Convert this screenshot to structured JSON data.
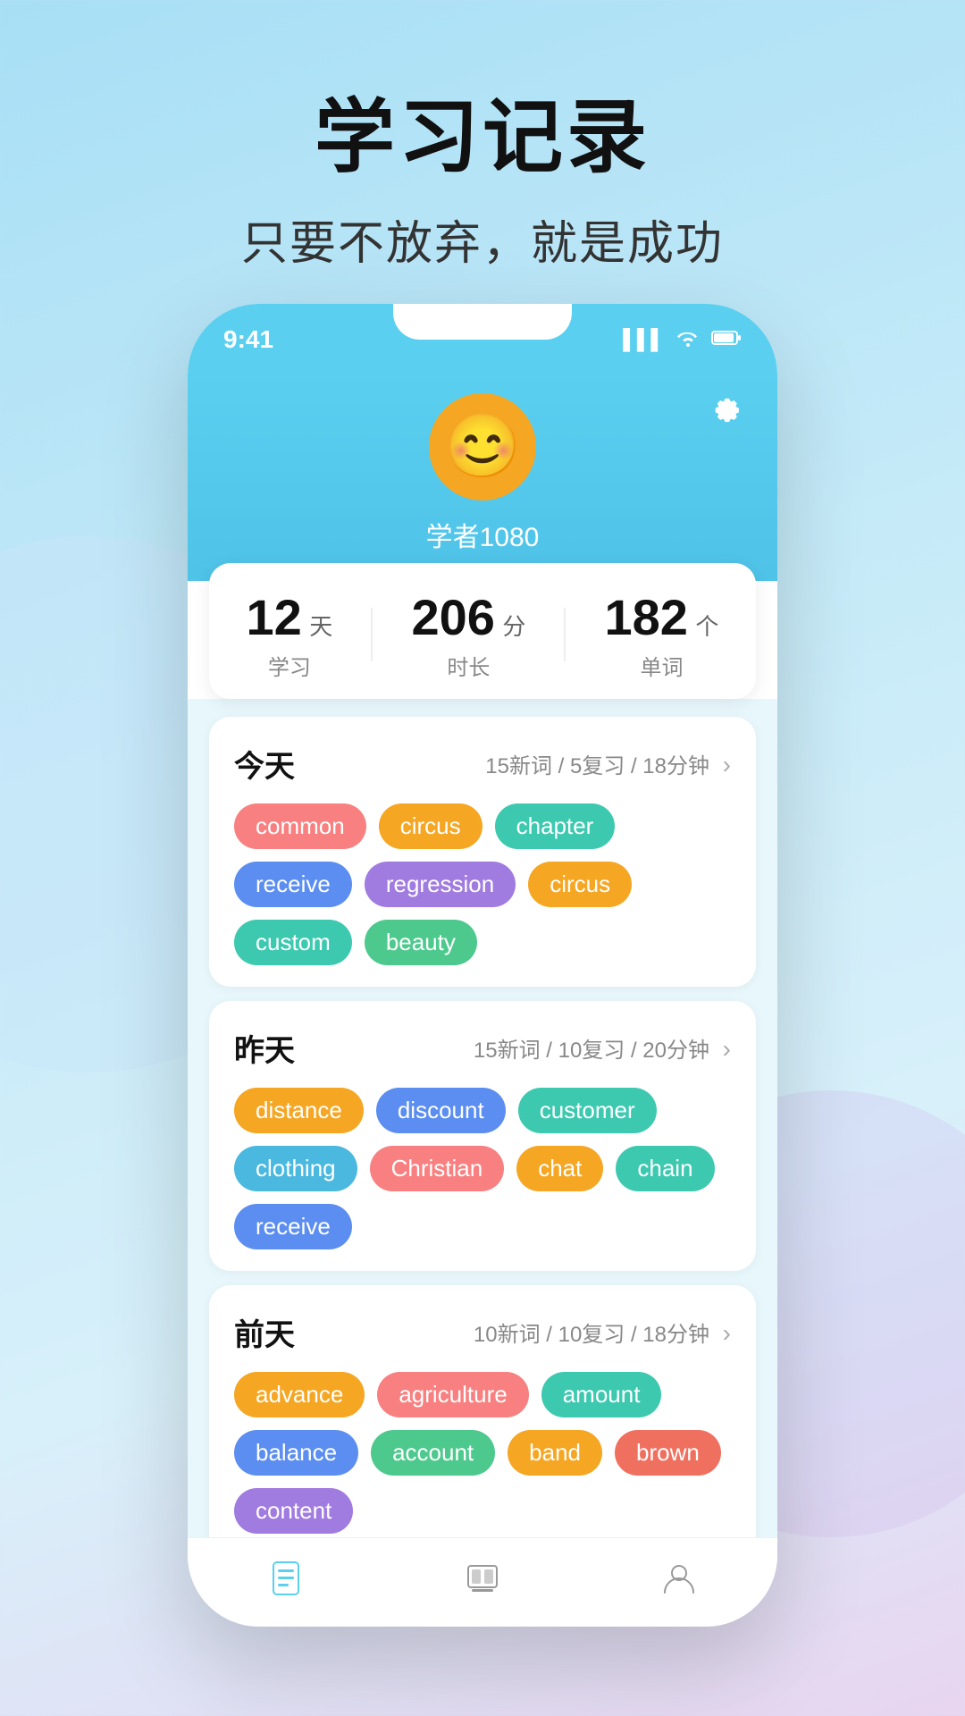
{
  "background": {
    "color": "#a8dff5"
  },
  "header": {
    "title": "学习记录",
    "subtitle": "只要不放弃，就是成功"
  },
  "phone": {
    "status_bar": {
      "time": "9:41",
      "signal": "▌▌▌",
      "wifi": "WiFi",
      "battery": "Battery"
    },
    "profile": {
      "username": "学者1080",
      "avatar_emoji": "😊"
    },
    "stats": {
      "days": "12",
      "days_unit": "天",
      "days_label": "学习",
      "minutes": "206",
      "minutes_unit": "分",
      "minutes_label": "时长",
      "words": "182",
      "words_unit": "个",
      "words_label": "单词"
    },
    "today": {
      "title": "今天",
      "stats": "15新词 / 5复习 / 18分钟",
      "words": [
        {
          "text": "common",
          "color": "tag-pink"
        },
        {
          "text": "circus",
          "color": "tag-orange"
        },
        {
          "text": "chapter",
          "color": "tag-teal"
        },
        {
          "text": "receive",
          "color": "tag-blue"
        },
        {
          "text": "regression",
          "color": "tag-purple"
        },
        {
          "text": "circus",
          "color": "tag-orange"
        },
        {
          "text": "custom",
          "color": "tag-teal"
        },
        {
          "text": "beauty",
          "color": "tag-green"
        }
      ]
    },
    "yesterday": {
      "title": "昨天",
      "stats": "15新词 / 10复习 / 20分钟",
      "words": [
        {
          "text": "distance",
          "color": "tag-orange"
        },
        {
          "text": "discount",
          "color": "tag-blue"
        },
        {
          "text": "customer",
          "color": "tag-teal"
        },
        {
          "text": "clothing",
          "color": "tag-sky"
        },
        {
          "text": "Christian",
          "color": "tag-pink"
        },
        {
          "text": "chat",
          "color": "tag-orange"
        },
        {
          "text": "chain",
          "color": "tag-teal"
        },
        {
          "text": "receive",
          "color": "tag-blue"
        }
      ]
    },
    "day_before": {
      "title": "前天",
      "stats": "10新词 / 10复习 / 18分钟",
      "words": [
        {
          "text": "advance",
          "color": "tag-orange"
        },
        {
          "text": "agriculture",
          "color": "tag-pink"
        },
        {
          "text": "amount",
          "color": "tag-teal"
        },
        {
          "text": "balance",
          "color": "tag-blue"
        },
        {
          "text": "account",
          "color": "tag-green"
        },
        {
          "text": "band",
          "color": "tag-orange"
        },
        {
          "text": "brown",
          "color": "tag-coral"
        },
        {
          "text": "content",
          "color": "tag-purple"
        }
      ]
    },
    "nav": {
      "items": [
        {
          "icon": "📋",
          "label": "records"
        },
        {
          "icon": "📚",
          "label": "study"
        },
        {
          "icon": "👤",
          "label": "profile"
        }
      ]
    }
  }
}
